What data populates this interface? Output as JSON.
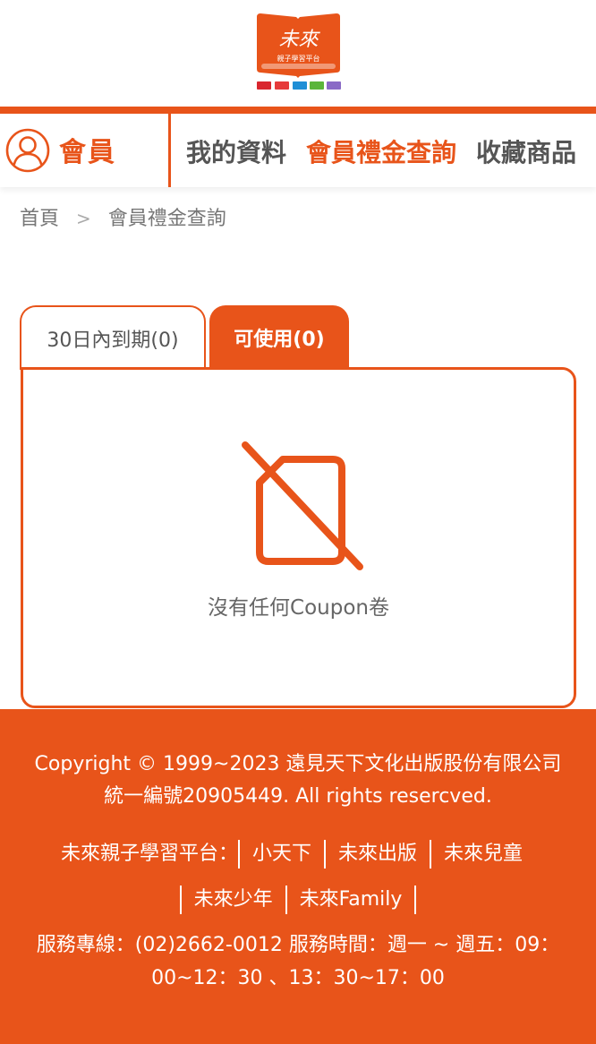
{
  "header": {
    "logo_text": "未來",
    "logo_subtitle": "親子學習平台",
    "brand_color": "#e8541a"
  },
  "member_nav": {
    "member_label": "會員",
    "links": [
      "我的資料",
      "會員禮金查詢",
      "收藏商品"
    ],
    "active_link": "會員禮金查詢"
  },
  "breadcrumb": {
    "home": "首頁",
    "separator": ">",
    "current": "會員禮金查詢"
  },
  "tabs": {
    "expiring": "30日內到期(0)",
    "usable": "可使用(0)",
    "active_tab": "可使用(0)"
  },
  "panel": {
    "icon": "no-coupon-icon",
    "empty_text": "沒有任何Coupon卷"
  },
  "footer": {
    "copyright_line1": "Copyright © 1999~2023 遠見天下文化出版股份有限公司",
    "copyright_line2": "統一編號20905449. All rights resercved.",
    "platform_label": "未來親子學習平台：",
    "platform_links": [
      "小天下",
      "未來出版",
      "未來兒童",
      "未來少年",
      "未來Family"
    ],
    "hotline": "服務專線：(02)2662-0012 服務時間：週一 ~ 週五：09：00~12：30 、13：30~17：00"
  }
}
